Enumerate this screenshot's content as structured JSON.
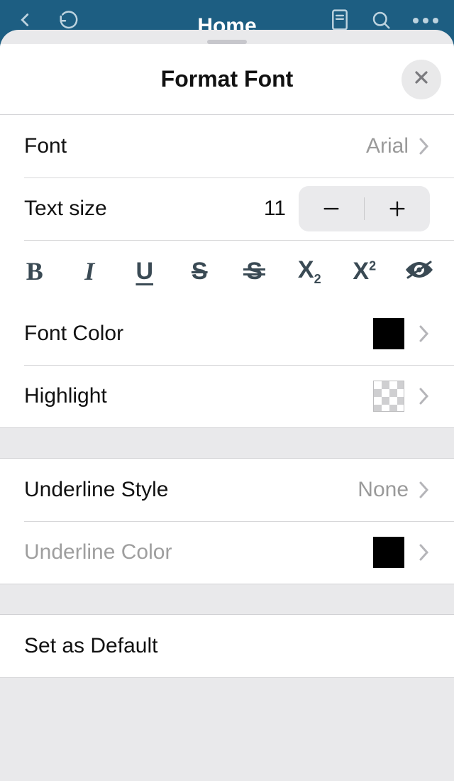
{
  "background": {
    "home_label": "Home"
  },
  "sheet": {
    "title": "Format Font",
    "font": {
      "label": "Font",
      "value": "Arial"
    },
    "text_size": {
      "label": "Text size",
      "value": "11"
    },
    "format_buttons": {
      "bold": "B",
      "italic": "I",
      "underline": "U",
      "strikethrough": "S",
      "double_strike": "S",
      "subscript": "X",
      "subscript_suffix": "2",
      "superscript": "X",
      "superscript_suffix": "2"
    },
    "font_color": {
      "label": "Font Color",
      "value": "#000000"
    },
    "highlight": {
      "label": "Highlight",
      "value": "none"
    },
    "underline_style": {
      "label": "Underline Style",
      "value": "None"
    },
    "underline_color": {
      "label": "Underline Color",
      "value": "#000000"
    },
    "set_default": {
      "label": "Set as Default"
    }
  }
}
